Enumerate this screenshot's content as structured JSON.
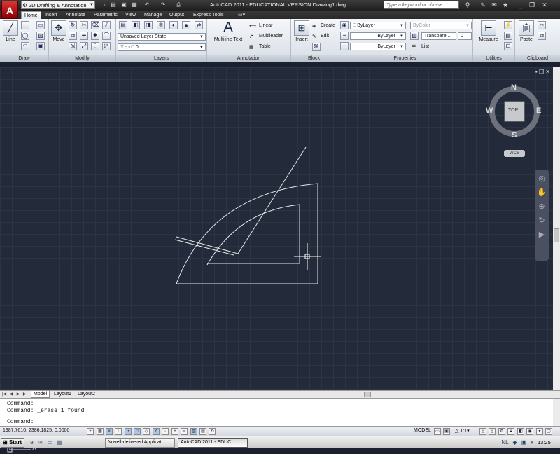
{
  "titlebar": {
    "app_logo": "A",
    "workspace": "2D Drafting & Annotation",
    "title": "AutoCAD 2011 - EDUCATIONAL VERSION    Drawing1.dwg",
    "search_placeholder": "Type a keyword or phrase"
  },
  "tabs": [
    "Home",
    "Insert",
    "Annotate",
    "Parametric",
    "View",
    "Manage",
    "Output",
    "Express Tools"
  ],
  "ribbon": {
    "draw": {
      "label": "Draw",
      "line": "Line"
    },
    "modify": {
      "label": "Modify",
      "move": "Move"
    },
    "layers": {
      "label": "Layers",
      "state": "Unsaved Layer State",
      "current": "0"
    },
    "annotation": {
      "label": "Annotation",
      "mtext": "Multiline Text",
      "linear": "Linear",
      "multileader": "Multileader",
      "table": "Table"
    },
    "block": {
      "label": "Block",
      "insert": "Insert",
      "create": "Create",
      "edit": "Edit"
    },
    "properties": {
      "label": "Properties",
      "color": "ByLayer",
      "linetype": "ByLayer",
      "lineweight": "ByLayer",
      "plotstyle": "ByColor",
      "transparency": "Transpare...",
      "transparency_value": "0",
      "list": "List"
    },
    "utilities": {
      "label": "Utilities",
      "measure": "Measure"
    },
    "clipboard": {
      "label": "Clipboard",
      "paste": "Paste"
    }
  },
  "viewcube": {
    "north": "N",
    "south": "S",
    "east": "E",
    "west": "W",
    "face": "TOP",
    "wcs": "WCS"
  },
  "ucs": {
    "x": "X",
    "y": "Y"
  },
  "layout_tabs": [
    "Model",
    "Layout1",
    "Layout2"
  ],
  "command_lines": [
    "Command:",
    "Command: _erase 1 found",
    "Command:"
  ],
  "status": {
    "coords": "1987.7610, 2386.1825, 0.0000",
    "model": "MODEL",
    "scale": "1:1"
  },
  "taskbar": {
    "start": "Start",
    "tasks": [
      "Novell-delivered Applicati...",
      "AutoCAD 2011 - EDUC..."
    ],
    "clock": "13:25"
  }
}
